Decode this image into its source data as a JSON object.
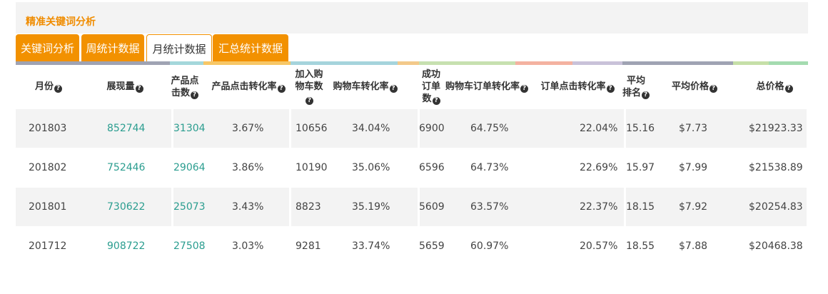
{
  "page_title": "精准关键词分析",
  "tabs": [
    "关键词分析",
    "周统计数据",
    "月统计数据",
    "汇总统计数据"
  ],
  "active_tab": "月统计数据",
  "color_bar": [
    "#9fa3b3",
    "#a4d7db",
    "#f7c766",
    "#a5d4dc",
    "#f3c98a",
    "#c7e0b0",
    "#f4b2a0",
    "#c9c2d9",
    "#9fa3b3",
    "#c6dfa8",
    "#a4dbb0"
  ],
  "columns": {
    "month": [
      "月份"
    ],
    "impressions": [
      "展现量"
    ],
    "product_clicks": [
      "产品点",
      "击数"
    ],
    "click_conv": [
      "产品点击转化率"
    ],
    "add_cart": [
      "加入购",
      "物车数"
    ],
    "cart_conv": [
      "购物车转化率"
    ],
    "orders": [
      "成功",
      "订单",
      "数"
    ],
    "cart_order_conv": [
      "购物车订单转化率"
    ],
    "order_click_conv": [
      "订单点击转化率"
    ],
    "avg_rank": [
      "平均",
      "排名"
    ],
    "avg_price": [
      "平均价格"
    ],
    "total_price": [
      "总价格"
    ]
  },
  "rows": [
    {
      "month": "201803",
      "impressions": "852744",
      "product_clicks": "31304",
      "click_conv": "3.67%",
      "add_cart": "10656",
      "cart_conv": "34.04%",
      "orders": "6900",
      "cart_order_conv": "64.75%",
      "order_click_conv": "22.04%",
      "avg_rank": "15.16",
      "avg_price": "$7.73",
      "total_price": "$21923.33"
    },
    {
      "month": "201802",
      "impressions": "752446",
      "product_clicks": "29064",
      "click_conv": "3.86%",
      "add_cart": "10190",
      "cart_conv": "35.06%",
      "orders": "6596",
      "cart_order_conv": "64.73%",
      "order_click_conv": "22.69%",
      "avg_rank": "15.97",
      "avg_price": "$7.99",
      "total_price": "$21538.89"
    },
    {
      "month": "201801",
      "impressions": "730622",
      "product_clicks": "25073",
      "click_conv": "3.43%",
      "add_cart": "8823",
      "cart_conv": "35.19%",
      "orders": "5609",
      "cart_order_conv": "63.57%",
      "order_click_conv": "22.37%",
      "avg_rank": "18.15",
      "avg_price": "$7.92",
      "total_price": "$20254.83"
    },
    {
      "month": "201712",
      "impressions": "908722",
      "product_clicks": "27508",
      "click_conv": "3.03%",
      "add_cart": "9281",
      "cart_conv": "33.74%",
      "orders": "5659",
      "cart_order_conv": "60.97%",
      "order_click_conv": "20.57%",
      "avg_rank": "18.55",
      "avg_price": "$7.88",
      "total_price": "$20468.38"
    }
  ]
}
